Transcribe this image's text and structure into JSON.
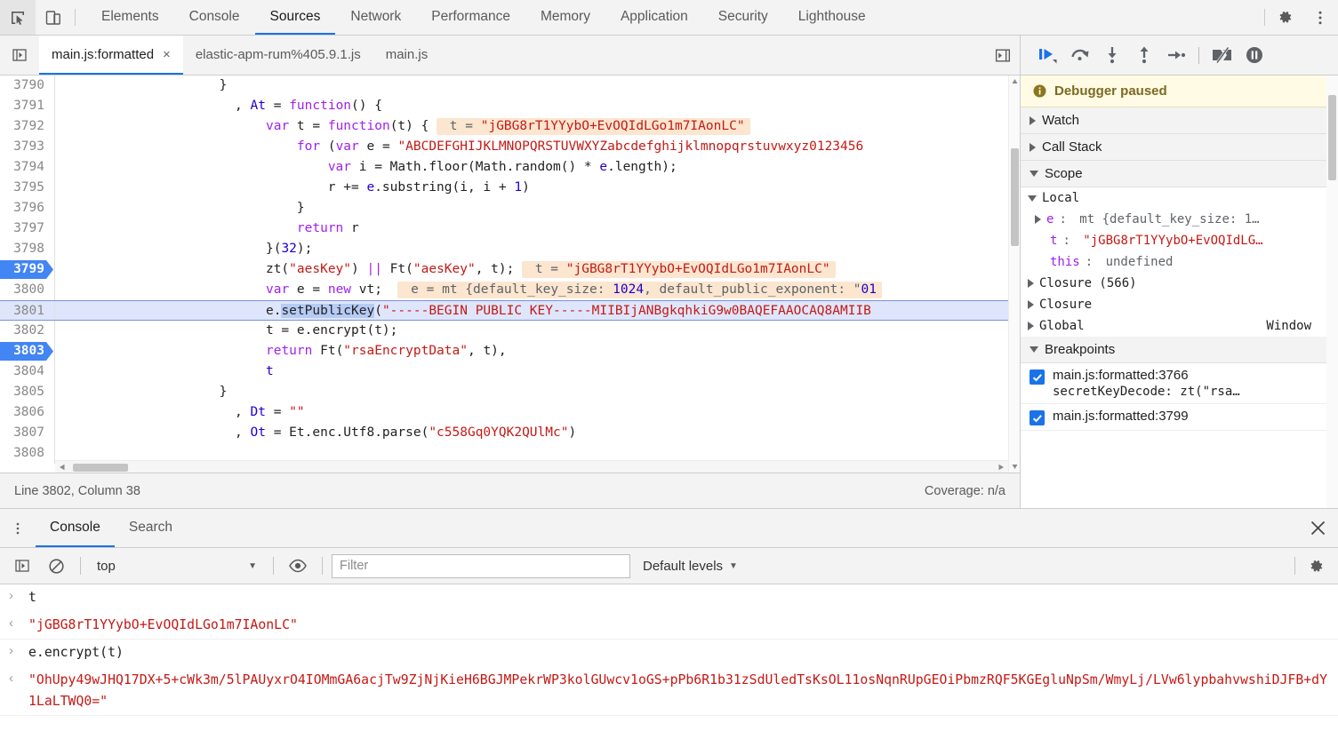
{
  "toolbar": {
    "inspect_icon": "cursor-inspect-icon",
    "device_icon": "device-toolbar-icon",
    "settings_icon": "gear-icon",
    "more_icon": "vertical-dots-icon",
    "panels": [
      {
        "label": "Elements",
        "active": false
      },
      {
        "label": "Console",
        "active": false
      },
      {
        "label": "Sources",
        "active": true
      },
      {
        "label": "Network",
        "active": false
      },
      {
        "label": "Performance",
        "active": false
      },
      {
        "label": "Memory",
        "active": false
      },
      {
        "label": "Application",
        "active": false
      },
      {
        "label": "Security",
        "active": false
      },
      {
        "label": "Lighthouse",
        "active": false
      }
    ]
  },
  "sources": {
    "navigator_toggle_icon": "show-navigator-icon",
    "more_tabs_icon": "show-more-tabs-icon",
    "file_tabs": [
      {
        "label": "main.js:formatted",
        "active": true,
        "closable": true,
        "close_label": "×"
      },
      {
        "label": "elastic-apm-rum%405.9.1.js",
        "active": false,
        "closable": false
      },
      {
        "label": "main.js",
        "active": false,
        "closable": false
      }
    ],
    "status": {
      "cursor": "Line 3802, Column 38",
      "coverage": "Coverage: n/a"
    },
    "lines": [
      {
        "num": "3790",
        "breakpoint": false,
        "executing": false,
        "tokens": [
          {
            "t": "                    }",
            "c": "p"
          }
        ]
      },
      {
        "num": "3791",
        "breakpoint": false,
        "executing": false,
        "tokens": [
          {
            "t": "                      , ",
            "c": "p"
          },
          {
            "t": "At",
            "c": "var"
          },
          {
            "t": " = ",
            "c": "p"
          },
          {
            "t": "function",
            "c": "k"
          },
          {
            "t": "() {",
            "c": "p"
          }
        ]
      },
      {
        "num": "3792",
        "breakpoint": false,
        "executing": false,
        "tokens": [
          {
            "t": "                          ",
            "c": "p"
          },
          {
            "t": "var",
            "c": "k"
          },
          {
            "t": " t = ",
            "c": "p"
          },
          {
            "t": "function",
            "c": "k"
          },
          {
            "t": "(t) { ",
            "c": "p"
          }
        ],
        "hint": {
          "prefix": " t = ",
          "value": "\"jGBG8rT1YYybO+EvOQIdLGo1m7IAonLC\"",
          "kind": "str"
        }
      },
      {
        "num": "3793",
        "breakpoint": false,
        "executing": false,
        "tokens": [
          {
            "t": "                              ",
            "c": "p"
          },
          {
            "t": "for",
            "c": "k"
          },
          {
            "t": " (",
            "c": "p"
          },
          {
            "t": "var",
            "c": "k"
          },
          {
            "t": " e = ",
            "c": "p"
          },
          {
            "t": "\"ABCDEFGHIJKLMNOPQRSTUVWXYZabcdefghijklmnopqrstuvwxyz0123456",
            "c": "s"
          }
        ]
      },
      {
        "num": "3794",
        "breakpoint": false,
        "executing": false,
        "tokens": [
          {
            "t": "                                  ",
            "c": "p"
          },
          {
            "t": "var",
            "c": "k"
          },
          {
            "t": " i = Math.floor(Math.random() * ",
            "c": "p"
          },
          {
            "t": "e",
            "c": "var"
          },
          {
            "t": ".length);",
            "c": "p"
          }
        ]
      },
      {
        "num": "3795",
        "breakpoint": false,
        "executing": false,
        "tokens": [
          {
            "t": "                                  r += ",
            "c": "p"
          },
          {
            "t": "e",
            "c": "var"
          },
          {
            "t": ".substring(i, i + ",
            "c": "p"
          },
          {
            "t": "1",
            "c": "n"
          },
          {
            "t": ")",
            "c": "p"
          }
        ]
      },
      {
        "num": "3796",
        "breakpoint": false,
        "executing": false,
        "tokens": [
          {
            "t": "                              }",
            "c": "p"
          }
        ]
      },
      {
        "num": "3797",
        "breakpoint": false,
        "executing": false,
        "tokens": [
          {
            "t": "                              ",
            "c": "p"
          },
          {
            "t": "return",
            "c": "k"
          },
          {
            "t": " r",
            "c": "p"
          }
        ]
      },
      {
        "num": "3798",
        "breakpoint": false,
        "executing": false,
        "tokens": [
          {
            "t": "                          }(",
            "c": "p"
          },
          {
            "t": "32",
            "c": "n"
          },
          {
            "t": ");",
            "c": "p"
          }
        ]
      },
      {
        "num": "3799",
        "breakpoint": true,
        "executing": false,
        "tokens": [
          {
            "t": "                          zt(",
            "c": "p"
          },
          {
            "t": "\"aesKey\"",
            "c": "s"
          },
          {
            "t": ") ",
            "c": "p"
          },
          {
            "t": "||",
            "c": "k"
          },
          {
            "t": " Ft(",
            "c": "p"
          },
          {
            "t": "\"aesKey\"",
            "c": "s"
          },
          {
            "t": ", t); ",
            "c": "p"
          }
        ],
        "hint": {
          "prefix": " t = ",
          "value": "\"jGBG8rT1YYybO+EvOQIdLGo1m7IAonLC\"",
          "kind": "str"
        }
      },
      {
        "num": "3800",
        "breakpoint": false,
        "executing": false,
        "tokens": [
          {
            "t": "                          ",
            "c": "p"
          },
          {
            "t": "var",
            "c": "k"
          },
          {
            "t": " e = ",
            "c": "p"
          },
          {
            "t": "new",
            "c": "k"
          },
          {
            "t": " vt;  ",
            "c": "p"
          }
        ],
        "hint": {
          "prefix": " e = mt {",
          "value": "default_key_size: 1024, default_public_exponent: \"01",
          "kind": "obj"
        }
      },
      {
        "num": "3801",
        "breakpoint": false,
        "executing": true,
        "tokens": [
          {
            "t": "                          e.",
            "c": "p"
          },
          {
            "t": "setPublicKey",
            "c": "sel"
          },
          {
            "t": "(",
            "c": "p"
          },
          {
            "t": "\"-----BEGIN PUBLIC KEY-----MIIBIjANBgkqhkiG9w0BAQEFAAOCAQ8AMIIB",
            "c": "s"
          }
        ]
      },
      {
        "num": "3802",
        "breakpoint": false,
        "executing": false,
        "tokens": [
          {
            "t": "                          t = e.encrypt(t);",
            "c": "p"
          }
        ]
      },
      {
        "num": "3803",
        "breakpoint": true,
        "executing": false,
        "tokens": [
          {
            "t": "                          ",
            "c": "p"
          },
          {
            "t": "return",
            "c": "k"
          },
          {
            "t": " Ft(",
            "c": "p"
          },
          {
            "t": "\"rsaEncryptData\"",
            "c": "s"
          },
          {
            "t": ", t),",
            "c": "p"
          }
        ]
      },
      {
        "num": "3804",
        "breakpoint": false,
        "executing": false,
        "tokens": [
          {
            "t": "                          ",
            "c": "p"
          },
          {
            "t": "t",
            "c": "var"
          }
        ]
      },
      {
        "num": "3805",
        "breakpoint": false,
        "executing": false,
        "tokens": [
          {
            "t": "                    }",
            "c": "p"
          }
        ]
      },
      {
        "num": "3806",
        "breakpoint": false,
        "executing": false,
        "tokens": [
          {
            "t": "                      , ",
            "c": "p"
          },
          {
            "t": "Dt",
            "c": "var"
          },
          {
            "t": " = ",
            "c": "p"
          },
          {
            "t": "\"\"",
            "c": "s"
          }
        ]
      },
      {
        "num": "3807",
        "breakpoint": false,
        "executing": false,
        "tokens": [
          {
            "t": "                      , ",
            "c": "p"
          },
          {
            "t": "Ot",
            "c": "var"
          },
          {
            "t": " = Et.enc.Utf8.parse(",
            "c": "p"
          },
          {
            "t": "\"c558Gq0YQK2QUlMc\"",
            "c": "s"
          },
          {
            "t": ")",
            "c": "p"
          }
        ]
      },
      {
        "num": "3808",
        "breakpoint": false,
        "executing": false,
        "tokens": []
      }
    ]
  },
  "debugger": {
    "controls": [
      {
        "name": "resume-script-execution",
        "icon": "resume-icon"
      },
      {
        "name": "step-over-next-function-call",
        "icon": "step-over-icon"
      },
      {
        "name": "step-into-next-function-call",
        "icon": "step-into-icon"
      },
      {
        "name": "step-out-of-current-function",
        "icon": "step-out-icon"
      },
      {
        "name": "step",
        "icon": "step-icon"
      },
      {
        "name": "deactivate-breakpoints",
        "icon": "deactivate-breakpoints-icon"
      },
      {
        "name": "pause-on-exceptions",
        "icon": "pause-on-exceptions-icon"
      }
    ],
    "paused_banner": {
      "icon": "info-icon",
      "text": "Debugger paused"
    },
    "sections": [
      {
        "label": "Watch",
        "expanded": false
      },
      {
        "label": "Call Stack",
        "expanded": false
      },
      {
        "label": "Scope",
        "expanded": true
      },
      {
        "label": "Breakpoints",
        "expanded": true
      }
    ],
    "scope": {
      "group": "Local",
      "entries": [
        {
          "expandable": true,
          "name": "e",
          "sep": ": ",
          "value": "mt {default_key_size: 1…",
          "kind": "obj",
          "numpart": ""
        },
        {
          "expandable": false,
          "name": "t",
          "sep": ": ",
          "value": "\"jGBG8rT1YYybO+EvOQIdLG…",
          "kind": "str"
        },
        {
          "expandable": false,
          "name": "this",
          "sep": ": ",
          "value": "undefined",
          "kind": "und"
        }
      ],
      "closures": [
        {
          "label": "Closure (566)",
          "right": ""
        },
        {
          "label": "Closure",
          "right": ""
        },
        {
          "label": "Global",
          "right": "Window"
        }
      ]
    },
    "breakpoints": [
      {
        "checked": true,
        "location": "main.js:formatted:3766",
        "source": "secretKeyDecode: zt(\"rsa…"
      },
      {
        "checked": true,
        "location": "main.js:formatted:3799",
        "source": ""
      }
    ]
  },
  "drawer": {
    "menu_icon": "vertical-dots-icon",
    "close_icon": "close-icon",
    "tabs": [
      {
        "label": "Console",
        "active": true
      },
      {
        "label": "Search",
        "active": false
      }
    ],
    "console_toolbar": {
      "sidebar_icon": "console-sidebar-icon",
      "clear_icon": "clear-console-icon",
      "context": "top",
      "context_caret": "▼",
      "eye_icon": "live-expression-icon",
      "filter_placeholder": "Filter",
      "filter_value": "",
      "levels_label": "Default levels",
      "levels_caret": "▼",
      "settings_icon": "gear-icon"
    },
    "messages": [
      {
        "kind": "input",
        "marker": "›",
        "text": "t"
      },
      {
        "kind": "output",
        "marker": "‹",
        "text": "\"jGBG8rT1YYybO+EvOQIdLGo1m7IAonLC\""
      },
      {
        "kind": "input",
        "marker": "›",
        "text": "e.encrypt(t)"
      },
      {
        "kind": "output",
        "marker": "‹",
        "text": "\"OhUpy49wJHQ17DX+5+cWk3m/5lPAUyxrO4IOMmGA6acjTw9ZjNjKieH6BGJMPekrWP3kolGUwcv1oGS+pPb6R1b31zSdUledTsKsOL11osNqnRUpGEOiPbmzRQF5KGEgluNpSm/WmyLj/LVw6lypbahvwshiDJFB+dY1LaLTWQ0=\""
      }
    ]
  },
  "colors": {
    "accent": "#1a73e8",
    "breakpoint": "#4285f4",
    "exec_line": "#dfe6fb",
    "hint_bg": "#fce6d0",
    "string": "#c41a16",
    "keyword": "#a020f0",
    "number": "#1c00cf",
    "paused_bg": "#fffbe5"
  }
}
